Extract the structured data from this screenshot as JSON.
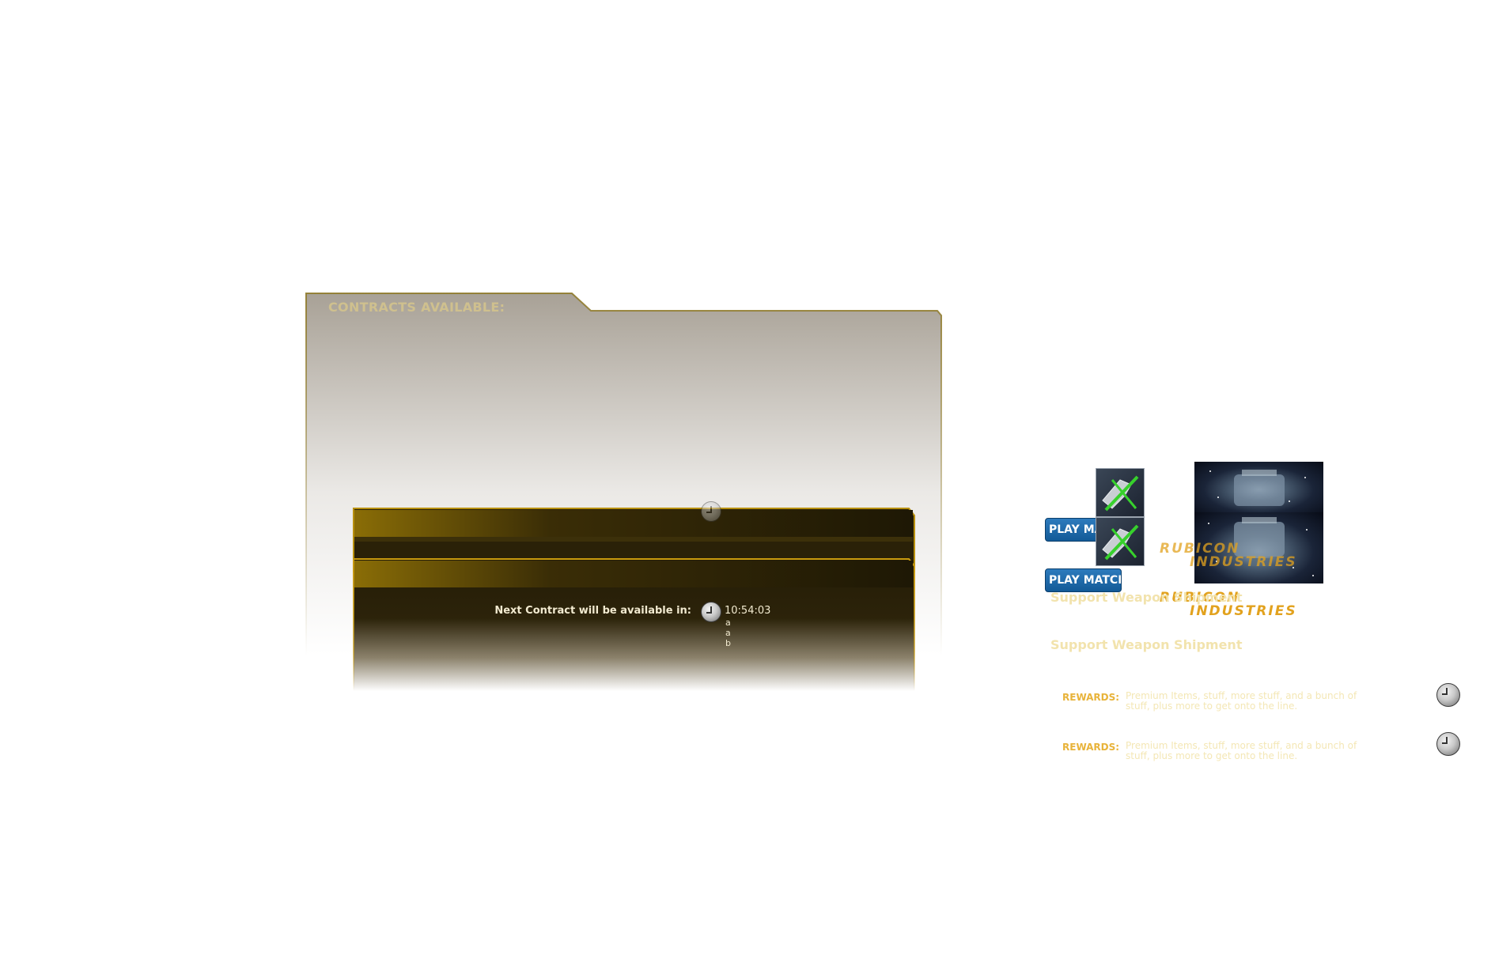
{
  "folder": {
    "title": "CONTRACTS AVAILABLE:"
  },
  "cards": [
    {
      "next_label": "Next Contract will be available in:",
      "timer": "10:54:03",
      "letters": [
        "a",
        "b"
      ]
    },
    {
      "next_label": "Next Contract will be available in:",
      "timer": "10:54:03",
      "letters": [
        "a",
        "a",
        "b"
      ]
    }
  ],
  "contracts": [
    {
      "play_label": "PLAY MATCH",
      "brand": [
        "RUBICON",
        "INDUSTRIES"
      ],
      "title": "Support Weapon Shipment",
      "rewards_label": "REWARDS:",
      "rewards_text": "Premium Items, stuff, more stuff, and a bunch of stuff, plus more to get onto the line."
    },
    {
      "play_label": "PLAY MATCH",
      "brand": [
        "RUBICON",
        "INDUSTRIES"
      ],
      "title": "Support Weapon Shipment",
      "rewards_label": "REWARDS:",
      "rewards_text": "Premium Items, stuff, more stuff, and a bunch of stuff, plus more to get onto the line."
    }
  ],
  "colors": {
    "gold": "#8a6d06",
    "dark": "#2a2108",
    "blue_button": "#1d6aa8",
    "brand_orange": "#e2a21e"
  },
  "icons": [
    "clock-icon",
    "weapon-icon"
  ]
}
